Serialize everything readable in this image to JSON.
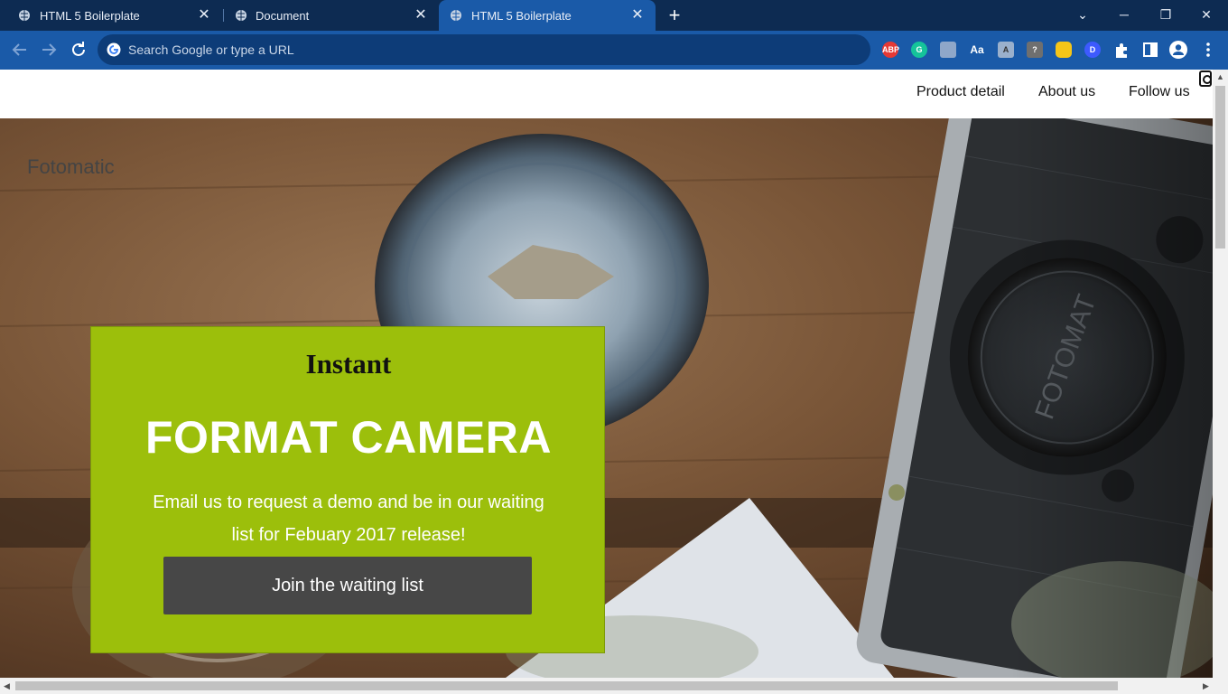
{
  "browser": {
    "tabs": [
      {
        "title": "HTML 5 Boilerplate",
        "active": false
      },
      {
        "title": "Document",
        "active": false
      },
      {
        "title": "HTML 5 Boilerplate",
        "active": true
      }
    ],
    "omnibox_placeholder": "Search Google or type a URL",
    "extensions": [
      "ABP",
      "G",
      "",
      "Aa",
      "A",
      "?",
      "",
      "D"
    ]
  },
  "page": {
    "logo": "Fotomatic",
    "nav": [
      "Product detail",
      "About us",
      "Follow us"
    ],
    "card": {
      "kicker": "Instant",
      "title": "FORMAT CAMERA",
      "text": "Email us to request a demo and be in our waiting list for Febuary 2017 release!",
      "button": "Join the waiting list"
    },
    "accent_color": "#9cbf0b",
    "button_color": "#474747"
  }
}
